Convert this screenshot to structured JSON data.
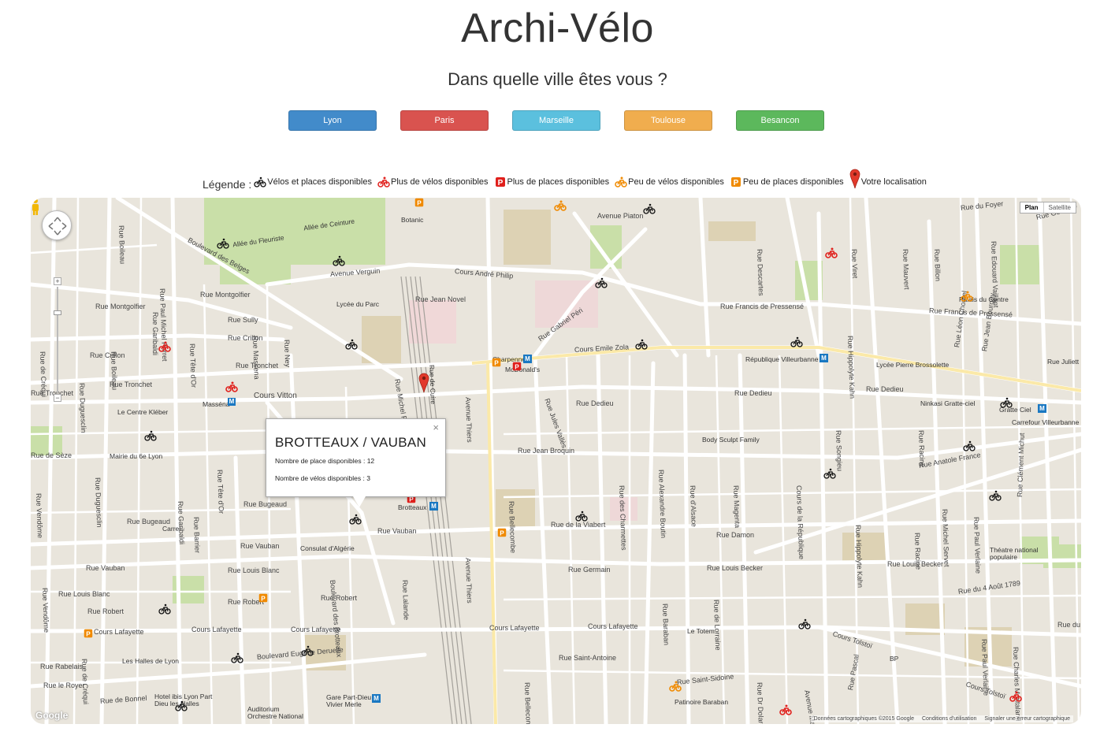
{
  "header": {
    "title": "Archi-Vélo",
    "subtitle": "Dans quelle ville êtes vous ?"
  },
  "cities": [
    {
      "label": "Lyon",
      "color": "#428bca"
    },
    {
      "label": "Paris",
      "color": "#d9534f"
    },
    {
      "label": "Marseille",
      "color": "#5bc0de"
    },
    {
      "label": "Toulouse",
      "color": "#f0ad4e"
    },
    {
      "label": "Besancon",
      "color": "#5cb85c"
    }
  ],
  "legend": {
    "label": "Légende :",
    "items": [
      {
        "icon": "bike-black-icon",
        "text": "Vélos et places disponibles"
      },
      {
        "icon": "bike-red-icon",
        "text": "Plus de vélos disponibles"
      },
      {
        "icon": "parking-red-icon",
        "text": "Plus de places disponibles"
      },
      {
        "icon": "bike-orange-icon",
        "text": "Peu de vélos disponibles"
      },
      {
        "icon": "parking-orange-icon",
        "text": "Peu de places disponibles"
      },
      {
        "icon": "location-pin-icon",
        "text": "Votre localisation"
      }
    ]
  },
  "map": {
    "maptype": {
      "plan": "Plan",
      "satellite": "Satellite"
    },
    "popup": {
      "title": "BROTTEAUX / VAUBAN",
      "places": "Nombre de place disponibles : 12",
      "velos": "Nombre de vélos disponibles : 3",
      "close": "×"
    },
    "google": "Google",
    "footer": [
      "Données cartographiques ©2015 Google",
      "Conditions d'utilisation",
      "Signaler une erreur cartographique"
    ],
    "streets": [
      "Boulevard des Belges",
      "Avenue Verguin",
      "Cours André Philip",
      "Rue Francis de Pressensé",
      "Cours Emile Zola",
      "Rue Montgolfier",
      "Rue Sully",
      "Rue Crillon",
      "Rue Tronchet",
      "Cours Vitton",
      "Rue Dedieu",
      "Rue Jean Broquin",
      "Rue de la Viabert",
      "Rue Vauban",
      "Rue Bugeaud",
      "Rue Germain",
      "Rue Louis Becker",
      "Rue du 4 Août 1789",
      "Cours Lafayette",
      "Cours Tolstoï",
      "Rue Saint-Antoine",
      "Rue Saint-Sidoine",
      "Boulevard Eugène Deruelle",
      "Rue de Bonnel",
      "Rue Anatole France",
      "Rue Garibaldi",
      "Rue Duguesclin",
      "Rue Vendôme",
      "Rue de Créqui",
      "Rue Robert",
      "Rue Ney",
      "Avenue Thiers",
      "Rue Michel Rambaud",
      "Boulevard des Brotteaux",
      "Rue Damon",
      "Avenue Piaton",
      "Rue Jean Novel",
      "Rue Gabriel Péri",
      "Rue Paul Michel Perret",
      "Rue de Sèze",
      "Rue Lalande",
      "Rue Boileau",
      "Rue Tête d'Or",
      "Rue Massena",
      "Rue Barrier",
      "Cours de la République",
      "Rue Louis Blanc",
      "Rue Vauban",
      "Rue Rabelais",
      "Rue le Royer",
      "Rue Bellecombe",
      "Rue des Charmettes",
      "Rue Alexandre Boutin",
      "Rue d'Alsace",
      "Rue Magenta",
      "Rue Baraban",
      "Rue de Lorraine",
      "Rue Racine",
      "Rue Michel Servet",
      "Rue Songieu",
      "Rue Hippolyte Kahn",
      "Rue Léon Chomel",
      "Rue Jean Bourgey",
      "Rue Geoffray",
      "Rue du Foyer",
      "Rue Edouard Vaillant",
      "Rue Descartes",
      "Rue Billon",
      "Rue Mauvert",
      "Rue Viret",
      "Rue Jules Vallès",
      "Rue Dr Dolard",
      "Rue Pascal",
      "Avenue Marc",
      "Rue Paul Verlaine",
      "Rue Charles Montaland",
      "Rue Clément Michut",
      "Rue du N"
    ],
    "pois": [
      "République Villeurbanne",
      "Lycée Pierre Brossolette",
      "Ninkasi Gratte-ciel",
      "Gratte Ciel",
      "Carrefour Villeurbanne",
      "Body Sculpt Family",
      "Théatre national populaire",
      "Le Totem",
      "Charpennes",
      "McDonald's",
      "Masséna",
      "Le Centre Kléber",
      "Mairie du 6e Lyon",
      "Carrel",
      "Consulat d'Algérie",
      "Brotteaux",
      "Les Halles de Lyon",
      "Hotel ibis Lyon Part Dieu les Halles",
      "Auditorium Orchestre National",
      "Gare Part-Dieu - Vivier Merle",
      "Patinoire Baraban",
      "Lycée du Parc",
      "Botanic",
      "Allée du Fleuriste",
      "Allée de Ceinture",
      "Palais du Centre",
      "BP",
      "Rue Juliett",
      "Rue de Cuire"
    ]
  }
}
